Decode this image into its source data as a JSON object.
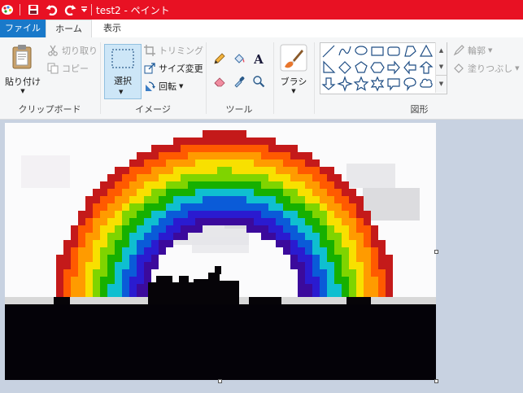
{
  "titlebar": {
    "title": "test2 - ペイント",
    "icons": [
      "paint-app-icon",
      "save-icon",
      "undo-icon",
      "redo-icon",
      "customize-quick-access-icon"
    ]
  },
  "tabs": {
    "file": "ファイル",
    "home": "ホーム",
    "view": "表示"
  },
  "ribbon": {
    "clipboard": {
      "paste": "貼り付け",
      "cut": "切り取り",
      "copy": "コピー",
      "group": "クリップボード"
    },
    "image": {
      "select": "選択",
      "crop": "トリミング",
      "resize": "サイズ変更",
      "rotate": "回転",
      "group": "イメージ"
    },
    "tools": {
      "group": "ツール",
      "items": [
        "pencil-icon",
        "fill-icon",
        "text-icon",
        "eraser-icon",
        "color-picker-icon",
        "magnifier-icon"
      ]
    },
    "brushes": {
      "label": "ブラシ"
    },
    "shapes": {
      "outline": "輪郭",
      "fill": "塗りつぶし",
      "group": "図形"
    }
  },
  "colors": {
    "titlebar": "#e81123",
    "file_tab": "#1979ca",
    "ribbon": "#f5f6f7",
    "workspace": "#c8d2e1"
  }
}
